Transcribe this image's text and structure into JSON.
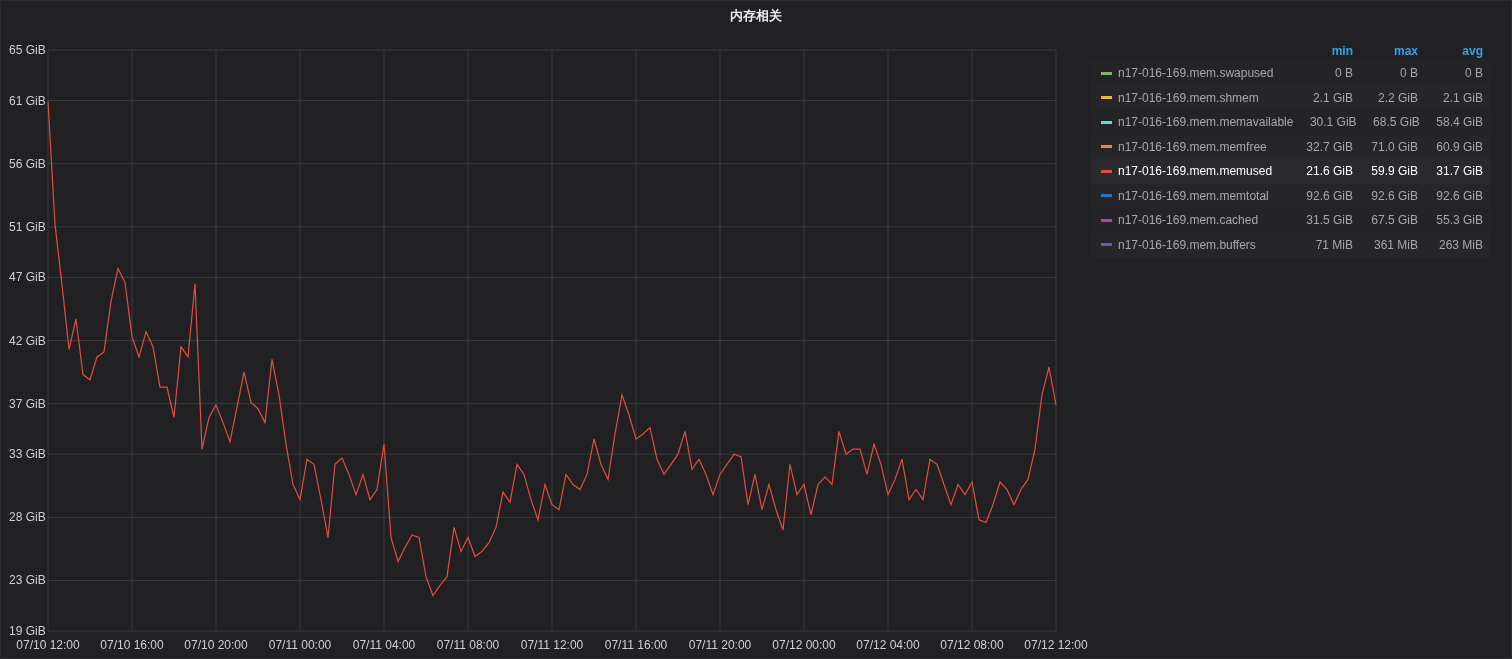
{
  "panel": {
    "title": "内存相关",
    "chart_data": {
      "type": "line",
      "grid": true,
      "ylim": [
        19,
        65
      ],
      "categories": [
        "07/10 12:00",
        null,
        null,
        null,
        null,
        null,
        null,
        null,
        null,
        null,
        null,
        null,
        "07/10 16:00",
        null,
        null,
        null,
        null,
        null,
        null,
        null,
        null,
        null,
        null,
        null,
        "07/10 20:00",
        null,
        null,
        null,
        null,
        null,
        null,
        null,
        null,
        null,
        null,
        null,
        "07/11 00:00",
        null,
        null,
        null,
        null,
        null,
        null,
        null,
        null,
        null,
        null,
        null,
        "07/11 04:00",
        null,
        null,
        null,
        null,
        null,
        null,
        null,
        null,
        null,
        null,
        null,
        "07/11 08:00",
        null,
        null,
        null,
        null,
        null,
        null,
        null,
        null,
        null,
        null,
        null,
        "07/11 12:00",
        null,
        null,
        null,
        null,
        null,
        null,
        null,
        null,
        null,
        null,
        null,
        "07/11 16:00",
        null,
        null,
        null,
        null,
        null,
        null,
        null,
        null,
        null,
        null,
        null,
        "07/11 20:00",
        null,
        null,
        null,
        null,
        null,
        null,
        null,
        null,
        null,
        null,
        null,
        "07/12 00:00",
        null,
        null,
        null,
        null,
        null,
        null,
        null,
        null,
        null,
        null,
        null,
        "07/12 04:00",
        null,
        null,
        null,
        null,
        null,
        null,
        null,
        null,
        null,
        null,
        null,
        "07/12 08:00",
        null,
        null,
        null,
        null,
        null,
        null,
        null,
        null,
        null,
        null,
        null,
        "07/12 12:00"
      ],
      "yticks": [
        {
          "value": 19,
          "label": "19 GiB"
        },
        {
          "value": 23,
          "label": "23 GiB"
        },
        {
          "value": 28,
          "label": "28 GiB"
        },
        {
          "value": 33,
          "label": "33 GiB"
        },
        {
          "value": 37,
          "label": "37 GiB"
        },
        {
          "value": 42,
          "label": "42 GiB"
        },
        {
          "value": 47,
          "label": "47 GiB"
        },
        {
          "value": 51,
          "label": "51 GiB"
        },
        {
          "value": 56,
          "label": "56 GiB"
        },
        {
          "value": 61,
          "label": "61 GiB"
        },
        {
          "value": 65,
          "label": "65 GiB"
        }
      ],
      "series": [
        {
          "color": "#e24d42",
          "values": [
            60.9,
            51.2,
            46.4,
            41.3,
            43.7,
            39.3,
            38.9,
            40.7,
            41.1,
            45.1,
            47.7,
            46.6,
            42.3,
            40.7,
            42.7,
            41.5,
            38.3,
            38.3,
            35.9,
            41.5,
            40.7,
            46.5,
            33.4,
            35.9,
            36.9,
            35.5,
            34.0,
            36.7,
            39.5,
            37.1,
            36.6,
            35.5,
            40.5,
            37.7,
            33.8,
            30.6,
            29.4,
            32.6,
            32.2,
            29.4,
            26.4,
            32.2,
            32.7,
            31.4,
            29.8,
            31.4,
            29.4,
            30.2,
            33.8,
            26.4,
            24.5,
            25.6,
            26.6,
            26.4,
            23.3,
            21.8,
            22.6,
            23.3,
            27.2,
            25.3,
            26.4,
            24.9,
            25.3,
            26.0,
            27.2,
            30.0,
            29.2,
            32.2,
            31.4,
            29.4,
            27.8,
            30.6,
            29.0,
            28.6,
            31.4,
            30.6,
            30.2,
            31.4,
            34.2,
            32.2,
            31.0,
            34.6,
            37.7,
            36.1,
            34.2,
            34.6,
            35.1,
            32.6,
            31.4,
            32.2,
            33.0,
            34.8,
            31.8,
            32.6,
            31.4,
            29.8,
            31.4,
            32.2,
            33.0,
            32.8,
            29.0,
            31.4,
            28.6,
            30.6,
            28.6,
            27.0,
            32.2,
            29.8,
            30.6,
            28.2,
            30.6,
            31.2,
            30.6,
            34.8,
            33.0,
            33.4,
            33.4,
            31.4,
            33.8,
            32.2,
            29.8,
            31.0,
            32.6,
            29.4,
            30.2,
            29.4,
            32.6,
            32.2,
            30.6,
            29.0,
            30.6,
            29.8,
            30.8,
            27.8,
            27.6,
            29.0,
            30.8,
            30.2,
            29.0,
            30.2,
            31.0,
            33.4,
            37.7,
            39.9,
            36.9
          ]
        }
      ]
    }
  },
  "legend": {
    "columns": [
      "min",
      "max",
      "avg"
    ],
    "items": [
      {
        "name": "n17-016-169.mem.swapused",
        "color": "#7eb26d",
        "selected": false,
        "min": "0 B",
        "max": "0 B",
        "avg": "0 B"
      },
      {
        "name": "n17-016-169.mem.shmem",
        "color": "#eab839",
        "selected": false,
        "min": "2.1 GiB",
        "max": "2.2 GiB",
        "avg": "2.1 GiB"
      },
      {
        "name": "n17-016-169.mem.memavailable",
        "color": "#6ed0e0",
        "selected": false,
        "min": "30.1 GiB",
        "max": "68.5 GiB",
        "avg": "58.4 GiB"
      },
      {
        "name": "n17-016-169.mem.memfree",
        "color": "#ef843c",
        "selected": false,
        "min": "32.7 GiB",
        "max": "71.0 GiB",
        "avg": "60.9 GiB"
      },
      {
        "name": "n17-016-169.mem.memused",
        "color": "#e24d42",
        "selected": true,
        "min": "21.6 GiB",
        "max": "59.9 GiB",
        "avg": "31.7 GiB"
      },
      {
        "name": "n17-016-169.mem.memtotal",
        "color": "#1f78c1",
        "selected": false,
        "min": "92.6 GiB",
        "max": "92.6 GiB",
        "avg": "92.6 GiB"
      },
      {
        "name": "n17-016-169.mem.cached",
        "color": "#ba43a9",
        "selected": false,
        "min": "31.5 GiB",
        "max": "67.5 GiB",
        "avg": "55.3 GiB"
      },
      {
        "name": "n17-016-169.mem.buffers",
        "color": "#705da0",
        "selected": false,
        "min": "71 MiB",
        "max": "361 MiB",
        "avg": "263 MiB"
      }
    ]
  }
}
